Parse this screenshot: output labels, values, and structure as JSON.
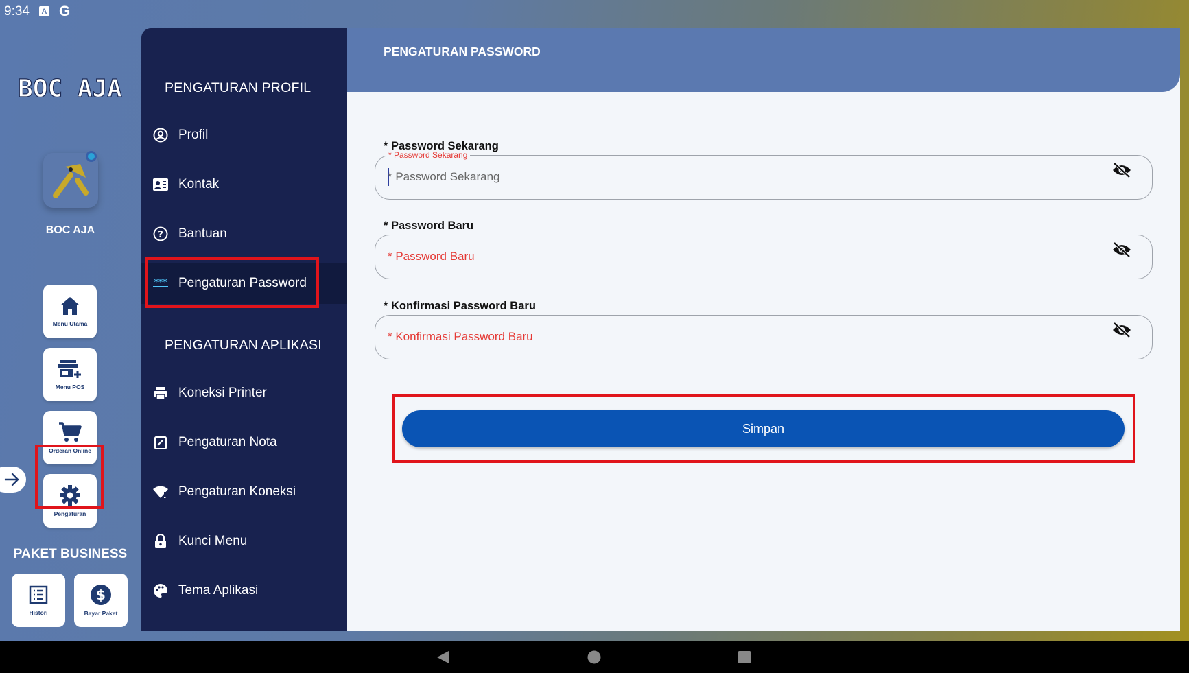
{
  "status_bar": {
    "time": "9:34",
    "a_icon_letter": "A",
    "g_icon_letter": "G"
  },
  "sidebar": {
    "logo_text": "BOC AJA",
    "brand_name": "BOC AJA",
    "nav": [
      {
        "label": "Menu Utama",
        "icon": "home-icon"
      },
      {
        "label": "Menu POS",
        "icon": "pos-icon"
      },
      {
        "label": "Orderan Online",
        "icon": "cart-icon"
      },
      {
        "label": "Pengaturan",
        "icon": "gear-icon"
      }
    ],
    "package_title": "PAKET BUSINESS",
    "package_items": [
      {
        "label": "Histori",
        "icon": "history-icon"
      },
      {
        "label": "Bayar Paket",
        "icon": "dollar-icon"
      }
    ]
  },
  "settings_menu": {
    "profile_section_title": "PENGATURAN PROFIL",
    "profile_items": [
      {
        "label": "Profil",
        "icon": "profile-icon"
      },
      {
        "label": "Kontak",
        "icon": "contact-icon"
      },
      {
        "label": "Bantuan",
        "icon": "help-icon"
      },
      {
        "label": "Pengaturan Password",
        "icon": "password-icon",
        "active": true
      }
    ],
    "app_section_title": "PENGATURAN APLIKASI",
    "app_items": [
      {
        "label": "Koneksi Printer",
        "icon": "printer-icon"
      },
      {
        "label": "Pengaturan Nota",
        "icon": "receipt-icon"
      },
      {
        "label": "Pengaturan Koneksi",
        "icon": "wifi-icon"
      },
      {
        "label": "Kunci Menu",
        "icon": "lock-icon"
      },
      {
        "label": "Tema Aplikasi",
        "icon": "palette-icon"
      }
    ]
  },
  "main": {
    "title": "PENGATURAN PASSWORD",
    "fields": [
      {
        "label": "* Password Sekarang",
        "placeholder": "* Password Sekarang",
        "float_label": "* Password Sekarang",
        "value": ""
      },
      {
        "label": "* Password Baru",
        "placeholder": "* Password Baru",
        "value": ""
      },
      {
        "label": "* Konfirmasi Password Baru",
        "placeholder": "* Konfirmasi Password Baru",
        "value": ""
      }
    ],
    "save_label": "Simpan"
  },
  "colors": {
    "accent": "#0a54b4",
    "panel": "#18224f",
    "header": "#5b79b0",
    "highlight": "#e0141b",
    "error_text": "#e53935"
  }
}
